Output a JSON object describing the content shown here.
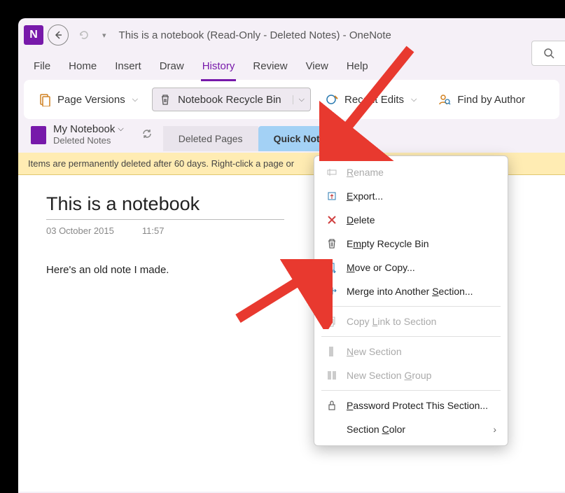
{
  "title": "This is a notebook (Read-Only - Deleted Notes)  -  OneNote",
  "menus": [
    "File",
    "Home",
    "Insert",
    "Draw",
    "History",
    "Review",
    "View",
    "Help"
  ],
  "active_menu": "History",
  "ribbon": {
    "page_versions": "Page Versions",
    "recycle_bin": "Notebook Recycle Bin",
    "recent_edits": "Recent Edits",
    "find_author": "Find by Author"
  },
  "notebook": {
    "name": "My Notebook",
    "sub": "Deleted Notes"
  },
  "tabs": {
    "deleted": "Deleted Pages",
    "quick": "Quick Notes"
  },
  "banner": "Items are permanently deleted after 60 days. Right-click a page or",
  "note": {
    "title": "This is a notebook",
    "date": "03 October 2015",
    "time": "11:57",
    "body": "Here's an old note I made."
  },
  "ctx": {
    "rename": "Rename",
    "export": "Export...",
    "delete": "Delete",
    "empty": "Empty Recycle Bin",
    "move": "Move or Copy...",
    "merge": "Merge into Another Section...",
    "copylink": "Copy Link to Section",
    "newsec": "New Section",
    "newgrp": "New Section Group",
    "password": "Password Protect This Section...",
    "color": "Section Color"
  }
}
